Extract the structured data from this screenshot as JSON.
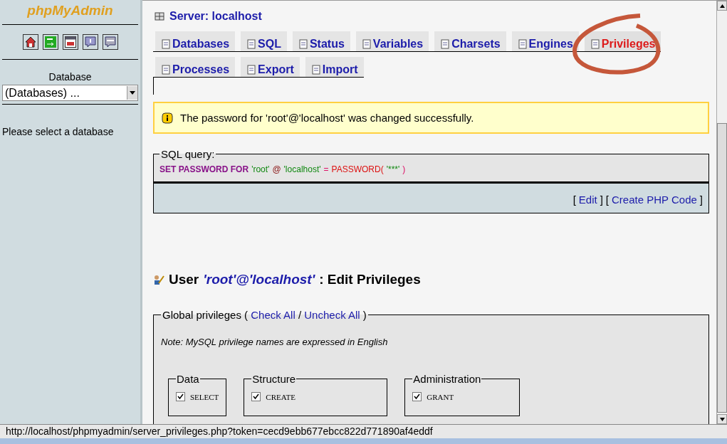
{
  "sidebar": {
    "logo": "phpMyAdmin",
    "database_label": "Database",
    "database_select": "(Databases) ...",
    "hint": "Please select a database"
  },
  "server_heading": "Server: localhost",
  "tabs": [
    [
      {
        "label": "Databases",
        "selected": false,
        "highlighted": false
      },
      {
        "label": "SQL",
        "selected": false,
        "highlighted": false
      },
      {
        "label": "Status",
        "selected": false,
        "highlighted": false
      },
      {
        "label": "Variables",
        "selected": false,
        "highlighted": false
      },
      {
        "label": "Charsets",
        "selected": false,
        "highlighted": false
      },
      {
        "label": "Engines",
        "selected": false,
        "highlighted": false
      },
      {
        "label": "Privileges",
        "selected": true,
        "highlighted": true
      }
    ],
    [
      {
        "label": "Processes",
        "selected": false,
        "highlighted": false
      },
      {
        "label": "Export",
        "selected": false,
        "highlighted": false
      },
      {
        "label": "Import",
        "selected": false,
        "highlighted": false
      }
    ]
  ],
  "message": "The password for 'root'@'localhost' was changed successfully.",
  "sql_query": {
    "legend": "SQL query:",
    "segments": [
      {
        "kind": "keyword",
        "text": "SET PASSWORD FOR"
      },
      {
        "kind": "string",
        "text": "'root'"
      },
      {
        "kind": "punct",
        "text": "@"
      },
      {
        "kind": "string",
        "text": "'localhost'"
      },
      {
        "kind": "operator",
        "text": "="
      },
      {
        "kind": "function",
        "text": "PASSWORD("
      },
      {
        "kind": "string",
        "text": "'***'"
      },
      {
        "kind": "operator",
        "text": ")"
      }
    ],
    "links": [
      {
        "open": "[",
        "label": "Edit",
        "close": "]"
      },
      {
        "open": "[",
        "label": "Create PHP Code",
        "close": "]"
      }
    ]
  },
  "user_heading": {
    "prefix": "User",
    "user": "'root'@'localhost'",
    "suffix": ": Edit Privileges"
  },
  "global_privileges": {
    "legend": "Global privileges",
    "paren_open": "(",
    "check_all": "Check All",
    "separator": "/",
    "uncheck_all": "Uncheck All",
    "paren_close": ")",
    "note": "Note: MySQL privilege names are expressed in English",
    "groups": [
      {
        "name": "Data",
        "items": [
          {
            "label": "SELECT",
            "checked": true
          }
        ]
      },
      {
        "name": "Structure",
        "items": [
          {
            "label": "CREATE",
            "checked": true
          }
        ]
      },
      {
        "name": "Administration",
        "items": [
          {
            "label": "GRANT",
            "checked": true
          }
        ]
      }
    ]
  },
  "status_bar": "http://localhost/phpmyadmin/server_privileges.php?token=cecd9ebb677ebcc822d771890af4eddf"
}
